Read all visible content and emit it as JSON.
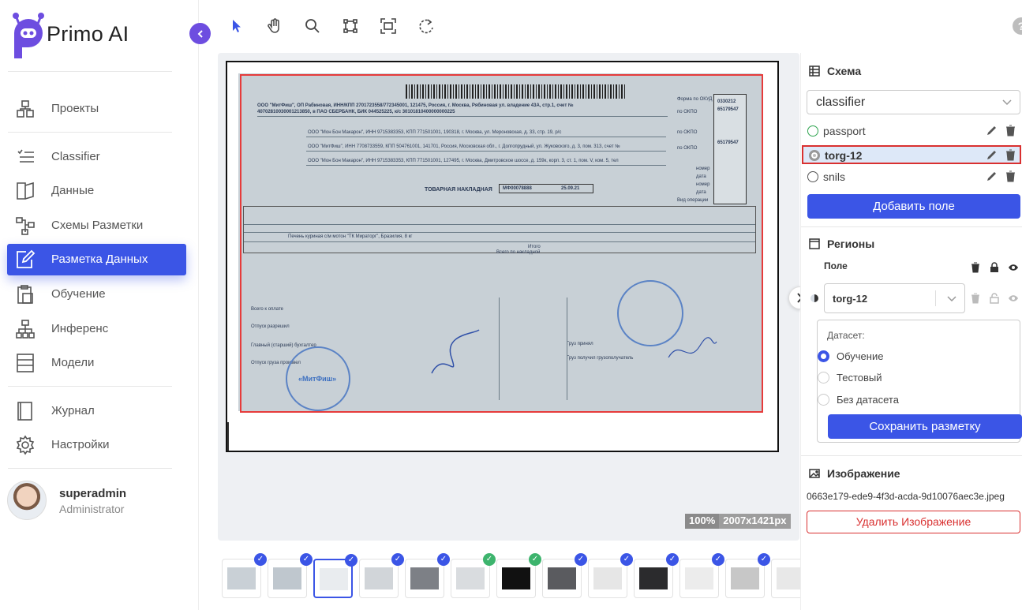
{
  "app": {
    "name": "Primo AI"
  },
  "sidebar": {
    "items": [
      {
        "label": "Проекты",
        "icon": "projects-icon"
      },
      {
        "label": "Classifier",
        "icon": "list-check-icon"
      },
      {
        "label": "Данные",
        "icon": "map-icon"
      },
      {
        "label": "Схемы Разметки",
        "icon": "schema-icon"
      },
      {
        "label": "Разметка Данных",
        "icon": "edit-icon",
        "active": true
      },
      {
        "label": "Обучение",
        "icon": "clipboard-icon"
      },
      {
        "label": "Инференс",
        "icon": "sitemap-icon"
      },
      {
        "label": "Модели",
        "icon": "table-icon"
      },
      {
        "label": "Журнал",
        "icon": "book-icon"
      },
      {
        "label": "Настройки",
        "icon": "gear-icon"
      }
    ]
  },
  "user": {
    "name": "superadmin",
    "role": "Administrator"
  },
  "toolbar": {
    "tools": [
      "pointer-icon",
      "hand-icon",
      "search-icon",
      "crop-icon",
      "fit-icon",
      "rotate-icon"
    ],
    "help": "?"
  },
  "viewer": {
    "zoom": "100%",
    "dimensions": "2007x1421px"
  },
  "document": {
    "lines": [
      "ООО \"МитФиш\", ОП Рабиновая, ИНН/КПП 2701723558/772345001, 121475, Россия, г. Москва, Рябиновая ул. владение 43А, стр.1, счет №",
      "40702810030001213850, в ПАО СБЕРБАНК, БИК 044525225, к/с 30101810400000000225",
      "ООО \"Мон Бон Макарон\", ИНН 9715383353, КПП 771501001, 190318, г. Москва, ул. Мероновская, д. 33, стр. 19, р/с",
      "ООО \"МитФиш\", ИНН 7708733559, КПП 504761001, 141701, Россия, Московская обл., г. Долгопрудный, ул. Жуковского, д. 3, пом. 313, счет №",
      "ООО \"Мон Бон Макарон\", ИНН 9715383353, КПП 771501001, 127495, г. Москва, Дмитровское шоссе, д. 159к, корп. 3, ст. 1, пом. V, ком. 5, тел",
      "ТОВАРНАЯ НАКЛАДНАЯ",
      "Печень куриная с/м мотон \"ТК Мираторг\", Бразилия, 8 кг",
      "Итого",
      "Всего по накладной",
      "Всего к оплате",
      "Отпуск разрешил",
      "Главный (старший) бухгалтер",
      "Отпуск груза произвел",
      "Груз принял",
      "Груз получил грузополучатель"
    ],
    "form_codes": [
      "0330212",
      "65179547",
      "65179547"
    ],
    "form_labels": [
      "Форма по ОКУД",
      "по ОКПО",
      "по ОКПО",
      "по ОКПО",
      "номер",
      "дата",
      "номер",
      "дата",
      "Вид операции"
    ],
    "invoice": {
      "number": "МФ00078888",
      "date": "25.09.21"
    },
    "stamp_text": "«МитФиш»"
  },
  "thumbnails": [
    {
      "checked": "blue"
    },
    {
      "checked": "blue"
    },
    {
      "checked": "blue",
      "selected": true
    },
    {
      "checked": "blue"
    },
    {
      "checked": "blue"
    },
    {
      "checked": "green"
    },
    {
      "checked": "green"
    },
    {
      "checked": "blue"
    },
    {
      "checked": "blue"
    },
    {
      "checked": "blue"
    },
    {
      "checked": "blue"
    },
    {
      "checked": "blue"
    },
    {
      "checked": "green"
    },
    {
      "checked": "blue"
    },
    {
      "checked": "blue"
    }
  ],
  "add_thumb": "+",
  "right": {
    "schema": {
      "title": "Схема",
      "selected": "classifier",
      "items": [
        {
          "label": "passport"
        },
        {
          "label": "torg-12",
          "selected": true
        },
        {
          "label": "snils"
        }
      ],
      "add_field_label": "Добавить поле"
    },
    "regions": {
      "title": "Регионы",
      "field_label": "Поле",
      "region_value": "torg-12",
      "dataset_title": "Датасет:",
      "dataset_options": [
        {
          "label": "Обучение",
          "checked": true
        },
        {
          "label": "Тестовый",
          "checked": false
        },
        {
          "label": "Без датасета",
          "checked": false
        }
      ],
      "save_label": "Сохранить разметку"
    },
    "image": {
      "title": "Изображение",
      "filename": "0663e179-ede9-4f3d-acda-9d10076aec3e.jpeg",
      "delete_label": "Удалить Изображение"
    }
  },
  "colors": {
    "accent": "#3b55e6",
    "logo": "#6d4de0",
    "danger": "#d93030",
    "success": "#3db46d"
  }
}
